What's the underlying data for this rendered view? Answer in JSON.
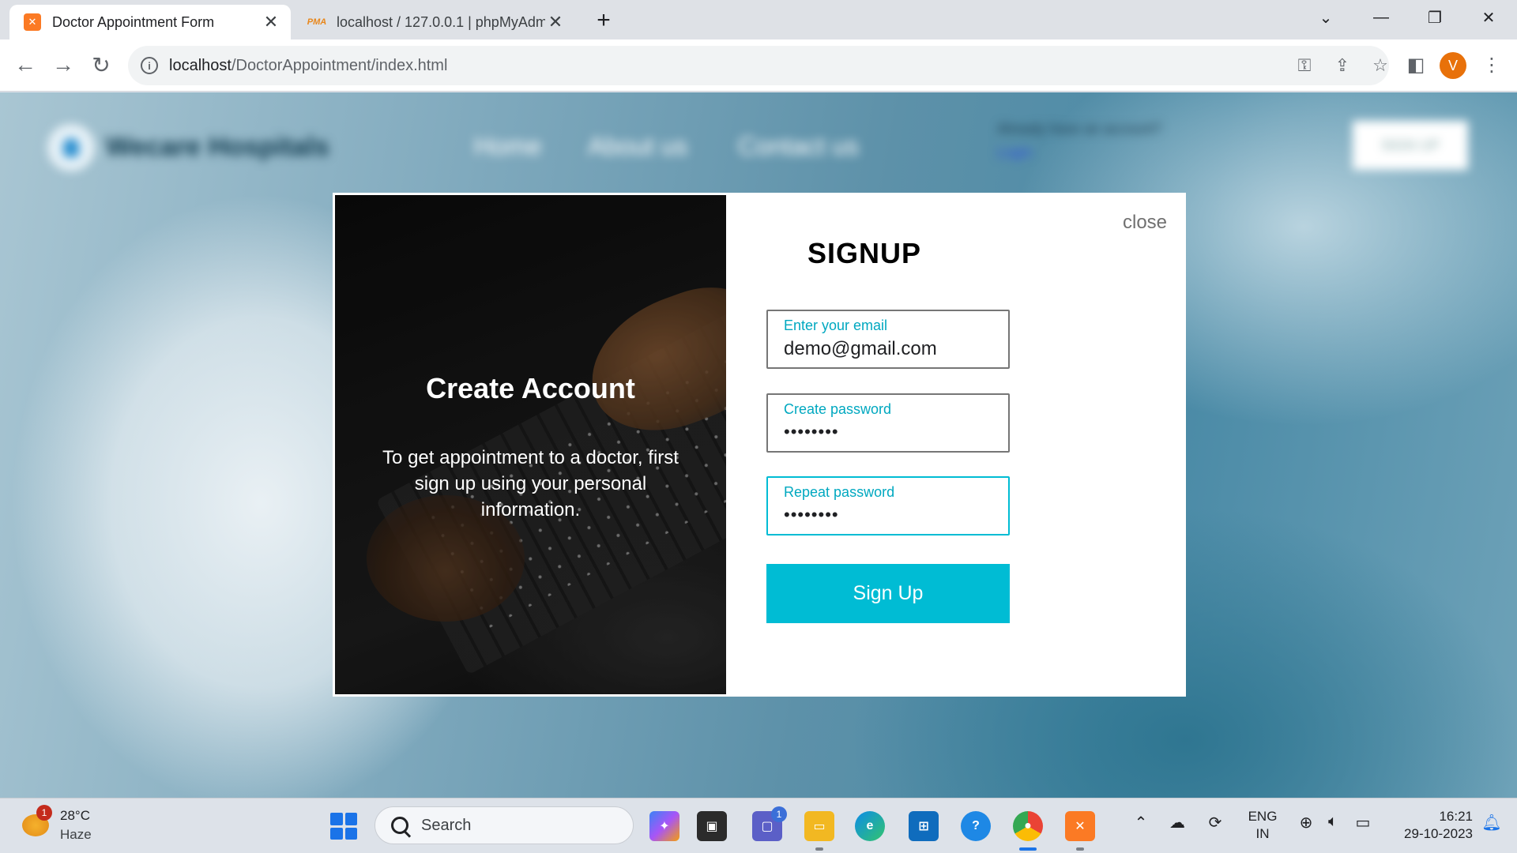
{
  "browser": {
    "tabs": [
      {
        "title": "Doctor Appointment Form",
        "favicon": "xampp-icon",
        "active": true
      },
      {
        "title": "localhost / 127.0.0.1 | phpMyAdmin",
        "favicon": "pma-icon",
        "active": false
      }
    ],
    "new_tab_symbol": "+",
    "address": {
      "host": "localhost",
      "path": "/DoctorAppointment/index.html"
    },
    "profile_initial": "V"
  },
  "page_bg": {
    "brand": "Wecare Hospitals",
    "nav": [
      "Home",
      "About us",
      "Contact us"
    ],
    "account_prompt": "Already have an account?",
    "login_link": "Login",
    "signup_button": "SIGN UP"
  },
  "modal": {
    "left": {
      "title": "Create Account",
      "text": "To get appointment to a doctor, first sign up using your personal information."
    },
    "close_label": "close",
    "form_title": "SIGNUP",
    "fields": [
      {
        "label": "Enter your email",
        "value": "demo@gmail.com",
        "type": "email"
      },
      {
        "label": "Create password",
        "value": "••••••••",
        "type": "password"
      },
      {
        "label": "Repeat password",
        "value": "••••••••",
        "type": "password"
      }
    ],
    "submit_label": "Sign Up",
    "accent_color": "#00bcd4"
  },
  "taskbar": {
    "weather": {
      "temp": "28°C",
      "condition": "Haze",
      "badge": "1"
    },
    "search_placeholder": "Search",
    "teams_badge": "1",
    "language": {
      "line1": "ENG",
      "line2": "IN"
    },
    "clock": {
      "time": "16:21",
      "date": "29-10-2023"
    }
  }
}
